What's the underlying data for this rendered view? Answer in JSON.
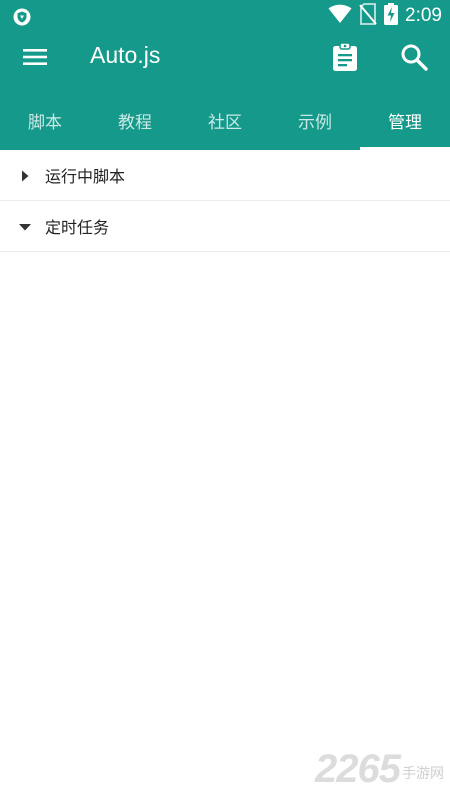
{
  "status_bar": {
    "time": "2:09"
  },
  "toolbar": {
    "menu_icon": "menu-icon",
    "title": "Auto.js",
    "clipboard_icon": "clipboard-icon",
    "search_icon": "search-icon"
  },
  "tabs": [
    {
      "label": "脚本"
    },
    {
      "label": "教程"
    },
    {
      "label": "社区"
    },
    {
      "label": "示例"
    },
    {
      "label": "管理",
      "active": true
    }
  ],
  "list": [
    {
      "label": "运行中脚本",
      "expanded": false
    },
    {
      "label": "定时任务",
      "expanded": true
    }
  ],
  "watermark": {
    "number": "2265",
    "text": "手游网"
  },
  "colors": {
    "primary": "#14998a",
    "text": "#222222",
    "divider": "#ececec"
  }
}
